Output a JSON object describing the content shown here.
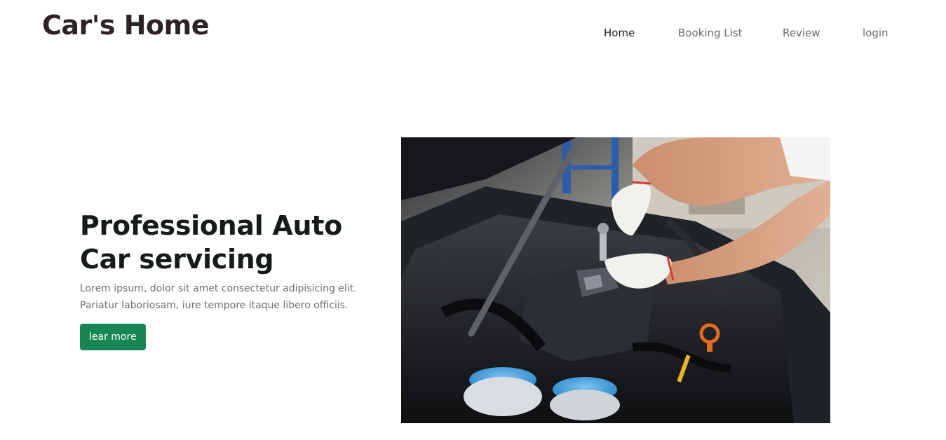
{
  "header": {
    "brand": "Car's Home",
    "nav": [
      {
        "label": "Home",
        "active": true
      },
      {
        "label": "Booking List",
        "active": false
      },
      {
        "label": "Review",
        "active": false
      },
      {
        "label": "login",
        "active": false
      }
    ]
  },
  "hero": {
    "title_line1": "Professional Auto",
    "title_line2": "Car servicing",
    "description_line1": "Lorem ipsum, dolor sit amet consectetur adipisicing elit.",
    "description_line2": "Pariatur laboriosam, iure tempore itaque libero officiis.",
    "button_label": "lear more",
    "image_subject": "mechanic-working-on-car-engine-photo"
  },
  "colors": {
    "brand_text": "#2d2324",
    "button_bg": "#198754",
    "title_text": "#151b1b",
    "body_text": "#6b6f72"
  }
}
